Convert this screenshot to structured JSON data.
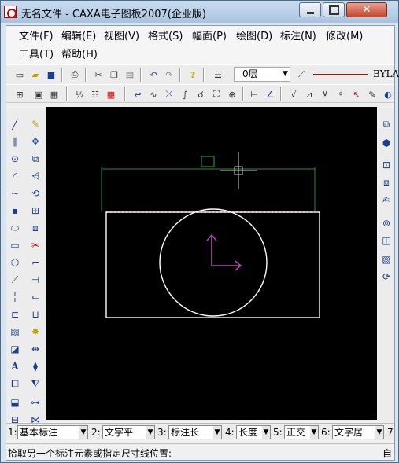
{
  "window": {
    "title": "无名文件 - CAXA电子图板2007(企业版)",
    "close_glyph": "✕"
  },
  "menu": {
    "row1": [
      "文件(F)",
      "编辑(E)",
      "视图(V)",
      "格式(S)",
      "幅面(P)",
      "绘图(D)",
      "标注(N)",
      "修改(M)"
    ],
    "row2": [
      "工具(T)",
      "帮助(H)"
    ]
  },
  "toolbar": {
    "layer": "0层",
    "linetype": "BYLAY"
  },
  "optbar": {
    "items": [
      {
        "num": "1:",
        "value": "基本标注"
      },
      {
        "num": "2:",
        "value": "文字平"
      },
      {
        "num": "3:",
        "value": "标注长"
      },
      {
        "num": "4:",
        "value": "长度"
      },
      {
        "num": "5:",
        "value": "正交"
      },
      {
        "num": "6:",
        "value": "文字居"
      },
      {
        "num": "7",
        "value": ""
      }
    ]
  },
  "status": {
    "prompt": "拾取另一个标注元素或指定尺寸线位置:",
    "right": "自"
  },
  "colors": {
    "canvas_bg": "#000000",
    "dimension_green": "#2e8b2e",
    "dashed_red": "#ff2020",
    "shape_white": "#ffffff",
    "coordinate_mark": "#b04ab0"
  }
}
